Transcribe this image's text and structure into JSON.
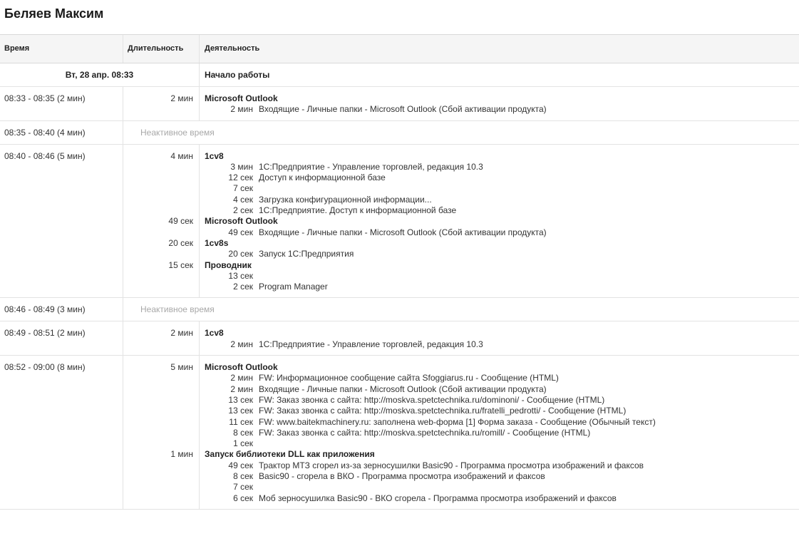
{
  "page": {
    "title": "Беляев Максим"
  },
  "table": {
    "headers": {
      "time": "Время",
      "duration": "Длительность",
      "activity": "Деятельность"
    },
    "day": {
      "date": "Вт, 28 апр. 08:33",
      "label": "Начало работы"
    },
    "idle_label": "Неактивное время",
    "rows": [
      {
        "time": "08:33 - 08:35 (2 мин)",
        "groups": [
          {
            "duration": "2 мин",
            "app": "Microsoft Outlook",
            "items": [
              {
                "duration": "2 мин",
                "title": "Входящие - Личные папки - Microsoft Outlook (Сбой активации продукта)"
              }
            ]
          }
        ]
      },
      {
        "time": "08:35 - 08:40 (4 мин)",
        "idle": true
      },
      {
        "time": "08:40 - 08:46 (5 мин)",
        "groups": [
          {
            "duration": "4 мин",
            "app": "1cv8",
            "items": [
              {
                "duration": "3 мин",
                "title": "1С:Предприятие - Управление торговлей, редакция 10.3"
              },
              {
                "duration": "12 сек",
                "title": "Доступ к информационной базе"
              },
              {
                "duration": "7 сек",
                "title": ""
              },
              {
                "duration": "4 сек",
                "title": "Загрузка конфигурационной информации..."
              },
              {
                "duration": "2 сек",
                "title": "1С:Предприятие. Доступ к информационной базе"
              }
            ]
          },
          {
            "duration": "49 сек",
            "app": "Microsoft Outlook",
            "items": [
              {
                "duration": "49 сек",
                "title": "Входящие - Личные папки - Microsoft Outlook (Сбой активации продукта)"
              }
            ]
          },
          {
            "duration": "20 сек",
            "app": "1cv8s",
            "items": [
              {
                "duration": "20 сек",
                "title": "Запуск 1С:Предприятия"
              }
            ]
          },
          {
            "duration": "15 сек",
            "app": "Проводник",
            "items": [
              {
                "duration": "13 сек",
                "title": ""
              },
              {
                "duration": "2 сек",
                "title": "Program Manager"
              }
            ]
          }
        ]
      },
      {
        "time": "08:46 - 08:49 (3 мин)",
        "idle": true
      },
      {
        "time": "08:49 - 08:51 (2 мин)",
        "groups": [
          {
            "duration": "2 мин",
            "app": "1cv8",
            "items": [
              {
                "duration": "2 мин",
                "title": "1С:Предприятие - Управление торговлей, редакция 10.3"
              }
            ]
          }
        ]
      },
      {
        "time": "08:52 - 09:00 (8 мин)",
        "groups": [
          {
            "duration": "5 мин",
            "app": "Microsoft Outlook",
            "items": [
              {
                "duration": "2 мин",
                "title": "FW: Информационное сообщение сайта Sfoggiarus.ru - Сообщение (HTML)"
              },
              {
                "duration": "2 мин",
                "title": "Входящие - Личные папки - Microsoft Outlook (Сбой активации продукта)"
              },
              {
                "duration": "13 сек",
                "title": "FW: Заказ звонка с сайта: http://moskva.spetctechnika.ru/dominoni/ - Сообщение (HTML)"
              },
              {
                "duration": "13 сек",
                "title": "FW: Заказ звонка с сайта: http://moskva.spetctechnika.ru/fratelli_pedrotti/ - Сообщение (HTML)"
              },
              {
                "duration": "11 сек",
                "title": "FW: www.baitekmachinery.ru: заполнена web-форма [1] Форма заказа - Сообщение (Обычный текст)"
              },
              {
                "duration": "8 сек",
                "title": "FW: Заказ звонка с сайта: http://moskva.spetctechnika.ru/romill/ - Сообщение (HTML)"
              },
              {
                "duration": "1 сек",
                "title": ""
              }
            ]
          },
          {
            "duration": "1 мин",
            "app": "Запуск библиотеки DLL как приложения",
            "items": [
              {
                "duration": "49 сек",
                "title": "Трактор МТЗ сгорел из-за зерносушилки Basic90 - Программа просмотра изображений и факсов"
              },
              {
                "duration": "8 сек",
                "title": "Basic90 - сгорела в ВКО - Программа просмотра изображений и факсов"
              },
              {
                "duration": "7 сек",
                "title": ""
              },
              {
                "duration": "6 сек",
                "title": "Моб зерносушилка Basic90 - ВКО сгорела - Программа просмотра изображений и факсов"
              }
            ]
          }
        ]
      }
    ]
  }
}
